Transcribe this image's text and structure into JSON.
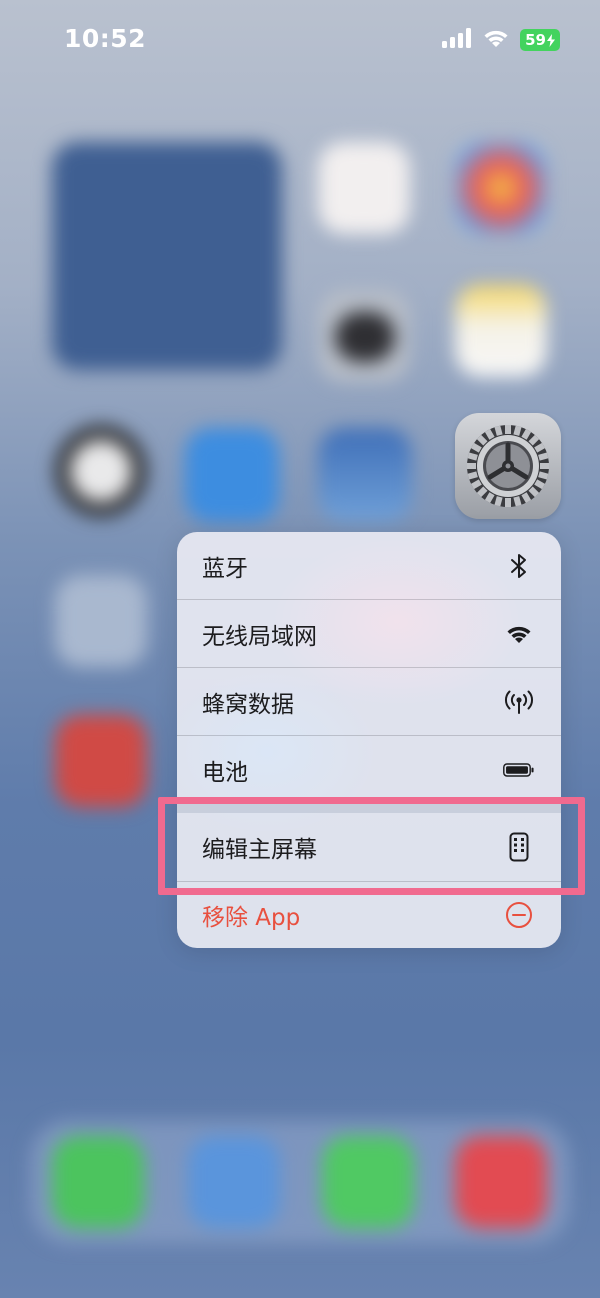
{
  "status_bar": {
    "time": "10:52",
    "battery_level": "59",
    "icons": [
      "cellular-signal-icon",
      "wifi-icon",
      "battery-charging-icon"
    ],
    "battery_color": "#43d35e"
  },
  "app_icon": {
    "icon": "settings-gear-icon"
  },
  "context_menu": {
    "items": [
      {
        "label": "蓝牙",
        "icon": "bluetooth-icon"
      },
      {
        "label": "无线局域网",
        "icon": "wifi-icon"
      },
      {
        "label": "蜂窝数据",
        "icon": "cellular-antenna-icon"
      },
      {
        "label": "电池",
        "icon": "battery-icon"
      },
      {
        "label": "编辑主屏幕",
        "icon": "phone-apps-icon"
      },
      {
        "label": "移除 App",
        "icon": "minus-circle-icon",
        "color": "#e8503f"
      }
    ]
  },
  "annotation": {
    "highlight_color": "#f06a8f",
    "highlighted_item": "编辑主屏幕"
  }
}
